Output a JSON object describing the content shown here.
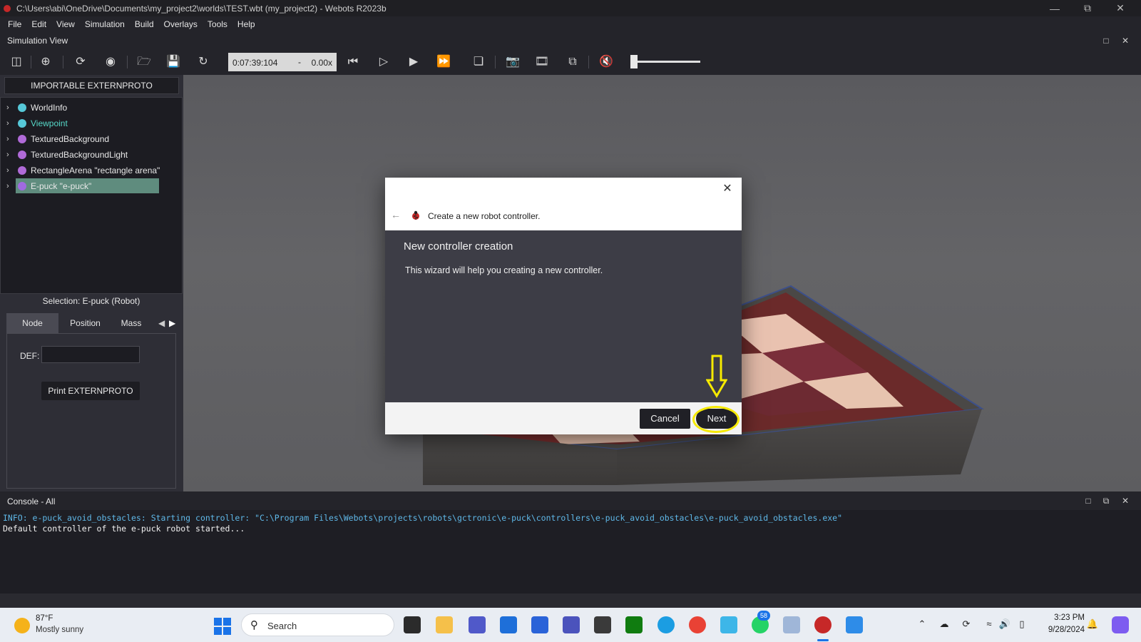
{
  "window": {
    "title": "C:\\Users\\abi\\OneDrive\\Documents\\my_project2\\worlds\\TEST.wbt (my_project2) - Webots R2023b"
  },
  "menu": [
    "File",
    "Edit",
    "View",
    "Simulation",
    "Build",
    "Overlays",
    "Tools",
    "Help"
  ],
  "simulation_view": {
    "label": "Simulation View"
  },
  "toolbar": {
    "time": "0:07:39:104",
    "dash": "-",
    "speed": "0.00x",
    "volume_level": 0.0
  },
  "scene_tree": {
    "extern_button": "IMPORTABLE EXTERNPROTO",
    "items": [
      {
        "label": "WorldInfo",
        "color": "#56c8d8"
      },
      {
        "label": "Viewpoint",
        "color": "#56c8d8",
        "text_color": "#56d8c8"
      },
      {
        "label": "TexturedBackground",
        "color": "#b06ad8"
      },
      {
        "label": "TexturedBackgroundLight",
        "color": "#b06ad8"
      },
      {
        "label": "RectangleArena \"rectangle arena\"",
        "color": "#b06ad8"
      },
      {
        "label": "E-puck \"e-puck\"",
        "color": "#a06ae0",
        "selected": true
      }
    ]
  },
  "field_editor": {
    "selection": "Selection: E-puck (Robot)",
    "tabs": [
      "Node",
      "Position",
      "Mass"
    ],
    "def_label": "DEF:",
    "def_value": "",
    "print_button": "Print EXTERNPROTO"
  },
  "dialog": {
    "title": "Create a new robot controller.",
    "heading": "New controller creation",
    "body": "This wizard will help you creating a new controller.",
    "cancel": "Cancel",
    "next": "Next",
    "highlight_color": "#f6ea00"
  },
  "console": {
    "label": "Console - All",
    "lines": [
      "INFO: e-puck_avoid_obstacles: Starting controller: \"C:\\Program Files\\Webots\\projects\\robots\\gctronic\\e-puck\\controllers\\e-puck_avoid_obstacles\\e-puck_avoid_obstacles.exe\"",
      "Default controller of the e-puck robot started..."
    ],
    "info_color": "#5fb8e8"
  },
  "taskbar": {
    "weather_temp": "87°F",
    "weather_desc": "Mostly sunny",
    "search_placeholder": "Search",
    "whatsapp_badge": "58",
    "time": "3:23 PM",
    "date": "9/28/2024"
  }
}
